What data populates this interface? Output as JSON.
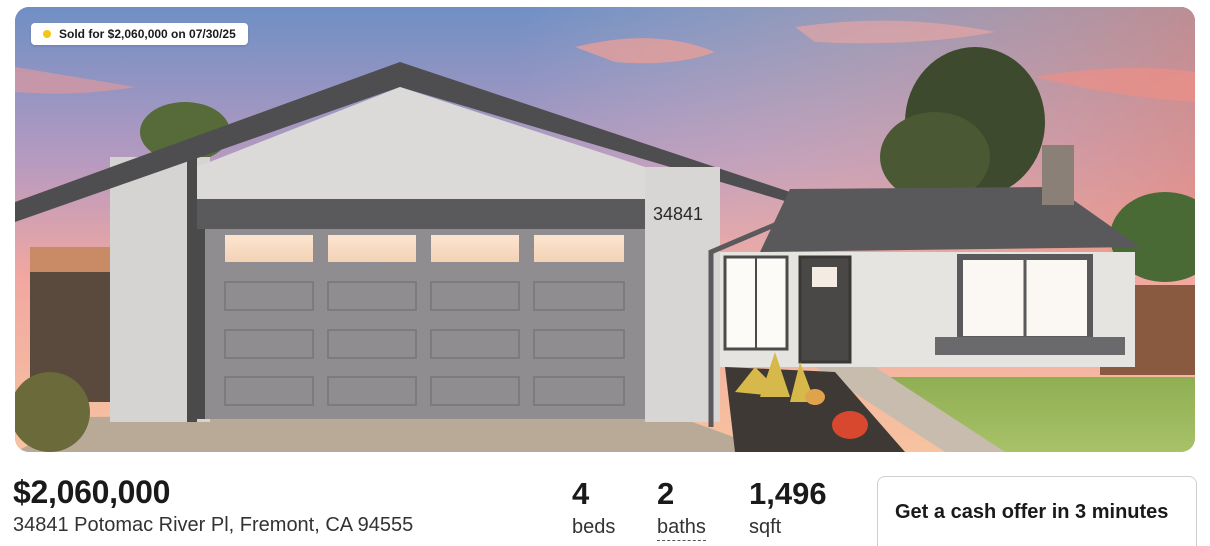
{
  "listing": {
    "status_badge": "Sold for $2,060,000 on 07/30/25",
    "house_number": "34841",
    "price": "$2,060,000",
    "address": "34841 Potomac River Pl, Fremont, CA 94555"
  },
  "stats": {
    "beds_value": "4",
    "beds_label": "beds",
    "baths_value": "2",
    "baths_label": "baths",
    "sqft_value": "1,496",
    "sqft_label": "sqft"
  },
  "cta": {
    "cash_offer_label": "Get a cash offer in 3 minutes"
  },
  "colors": {
    "badge_dot": "#f5c518",
    "text_primary": "#1a1a1a"
  }
}
